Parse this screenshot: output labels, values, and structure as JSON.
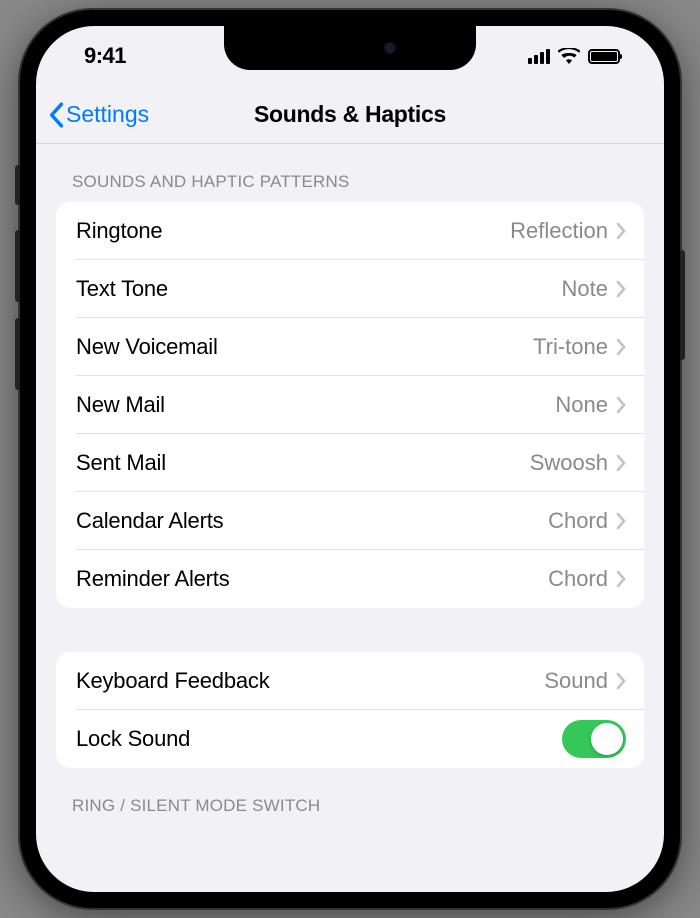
{
  "status": {
    "time": "9:41"
  },
  "nav": {
    "back": "Settings",
    "title": "Sounds & Haptics"
  },
  "section1": {
    "header": "SOUNDS AND HAPTIC PATTERNS"
  },
  "rows1": [
    {
      "label": "Ringtone",
      "value": "Reflection"
    },
    {
      "label": "Text Tone",
      "value": "Note"
    },
    {
      "label": "New Voicemail",
      "value": "Tri-tone"
    },
    {
      "label": "New Mail",
      "value": "None"
    },
    {
      "label": "Sent Mail",
      "value": "Swoosh"
    },
    {
      "label": "Calendar Alerts",
      "value": "Chord"
    },
    {
      "label": "Reminder Alerts",
      "value": "Chord"
    }
  ],
  "rows2": {
    "keyboard": {
      "label": "Keyboard Feedback",
      "value": "Sound"
    },
    "lock": {
      "label": "Lock Sound",
      "on": true
    }
  },
  "section3": {
    "header": "RING / SILENT MODE SWITCH"
  }
}
